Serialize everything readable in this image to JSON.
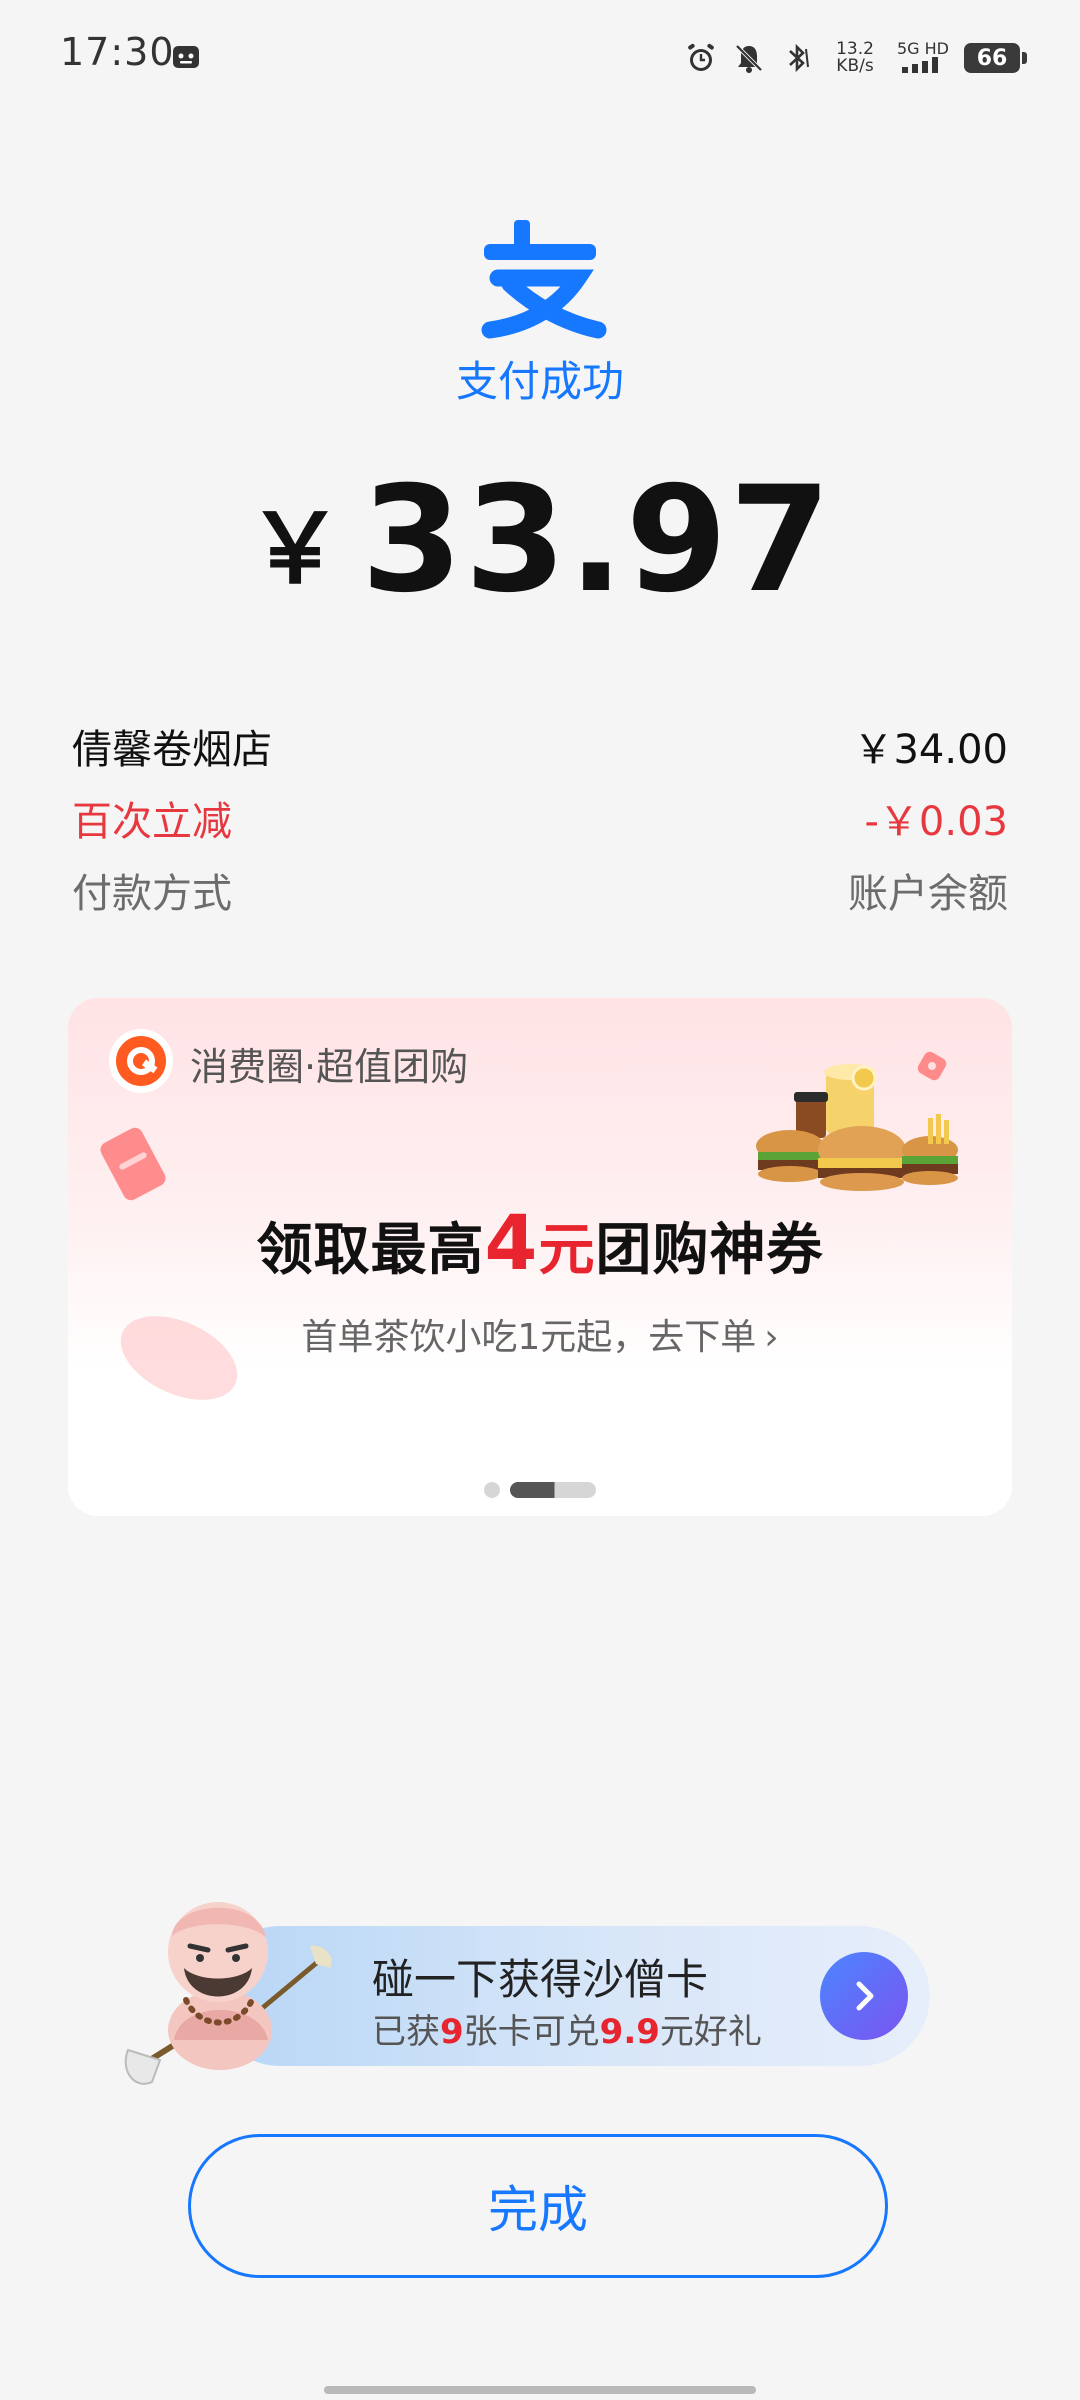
{
  "status_bar": {
    "time": "17:30",
    "net_speed_value": "13.2",
    "net_speed_unit": "KB/s",
    "network_type": "5G HD",
    "battery_level": "66"
  },
  "payment": {
    "title": "支付成功",
    "currency_symbol": "￥",
    "amount": "33.97"
  },
  "details": {
    "merchant_label": "倩馨卷烟店",
    "merchant_value": "￥34.00",
    "discount_label": "百次立减",
    "discount_value": "-￥0.03",
    "method_label": "付款方式",
    "method_value": "账户余额"
  },
  "promo": {
    "brand": "消费圈·超值团购",
    "headline_prefix": "领取最高",
    "headline_number": "4",
    "headline_unit": "元",
    "headline_suffix": "团购神券",
    "subtitle": "首单茶饮小吃1元起，去下单",
    "subtitle_chevron": "›",
    "carousel_total": 3,
    "carousel_active_index": 1
  },
  "tap_banner": {
    "title": "碰一下获得沙僧卡",
    "sub_prefix": "已获",
    "sub_count": "9",
    "sub_mid": "张卡可兑",
    "sub_amount": "9.9",
    "sub_suffix": "元好礼"
  },
  "done_button": {
    "label": "完成"
  },
  "colors": {
    "brand_blue": "#1677ff",
    "discount_red": "#e8383f",
    "promo_red": "#e8252e"
  }
}
